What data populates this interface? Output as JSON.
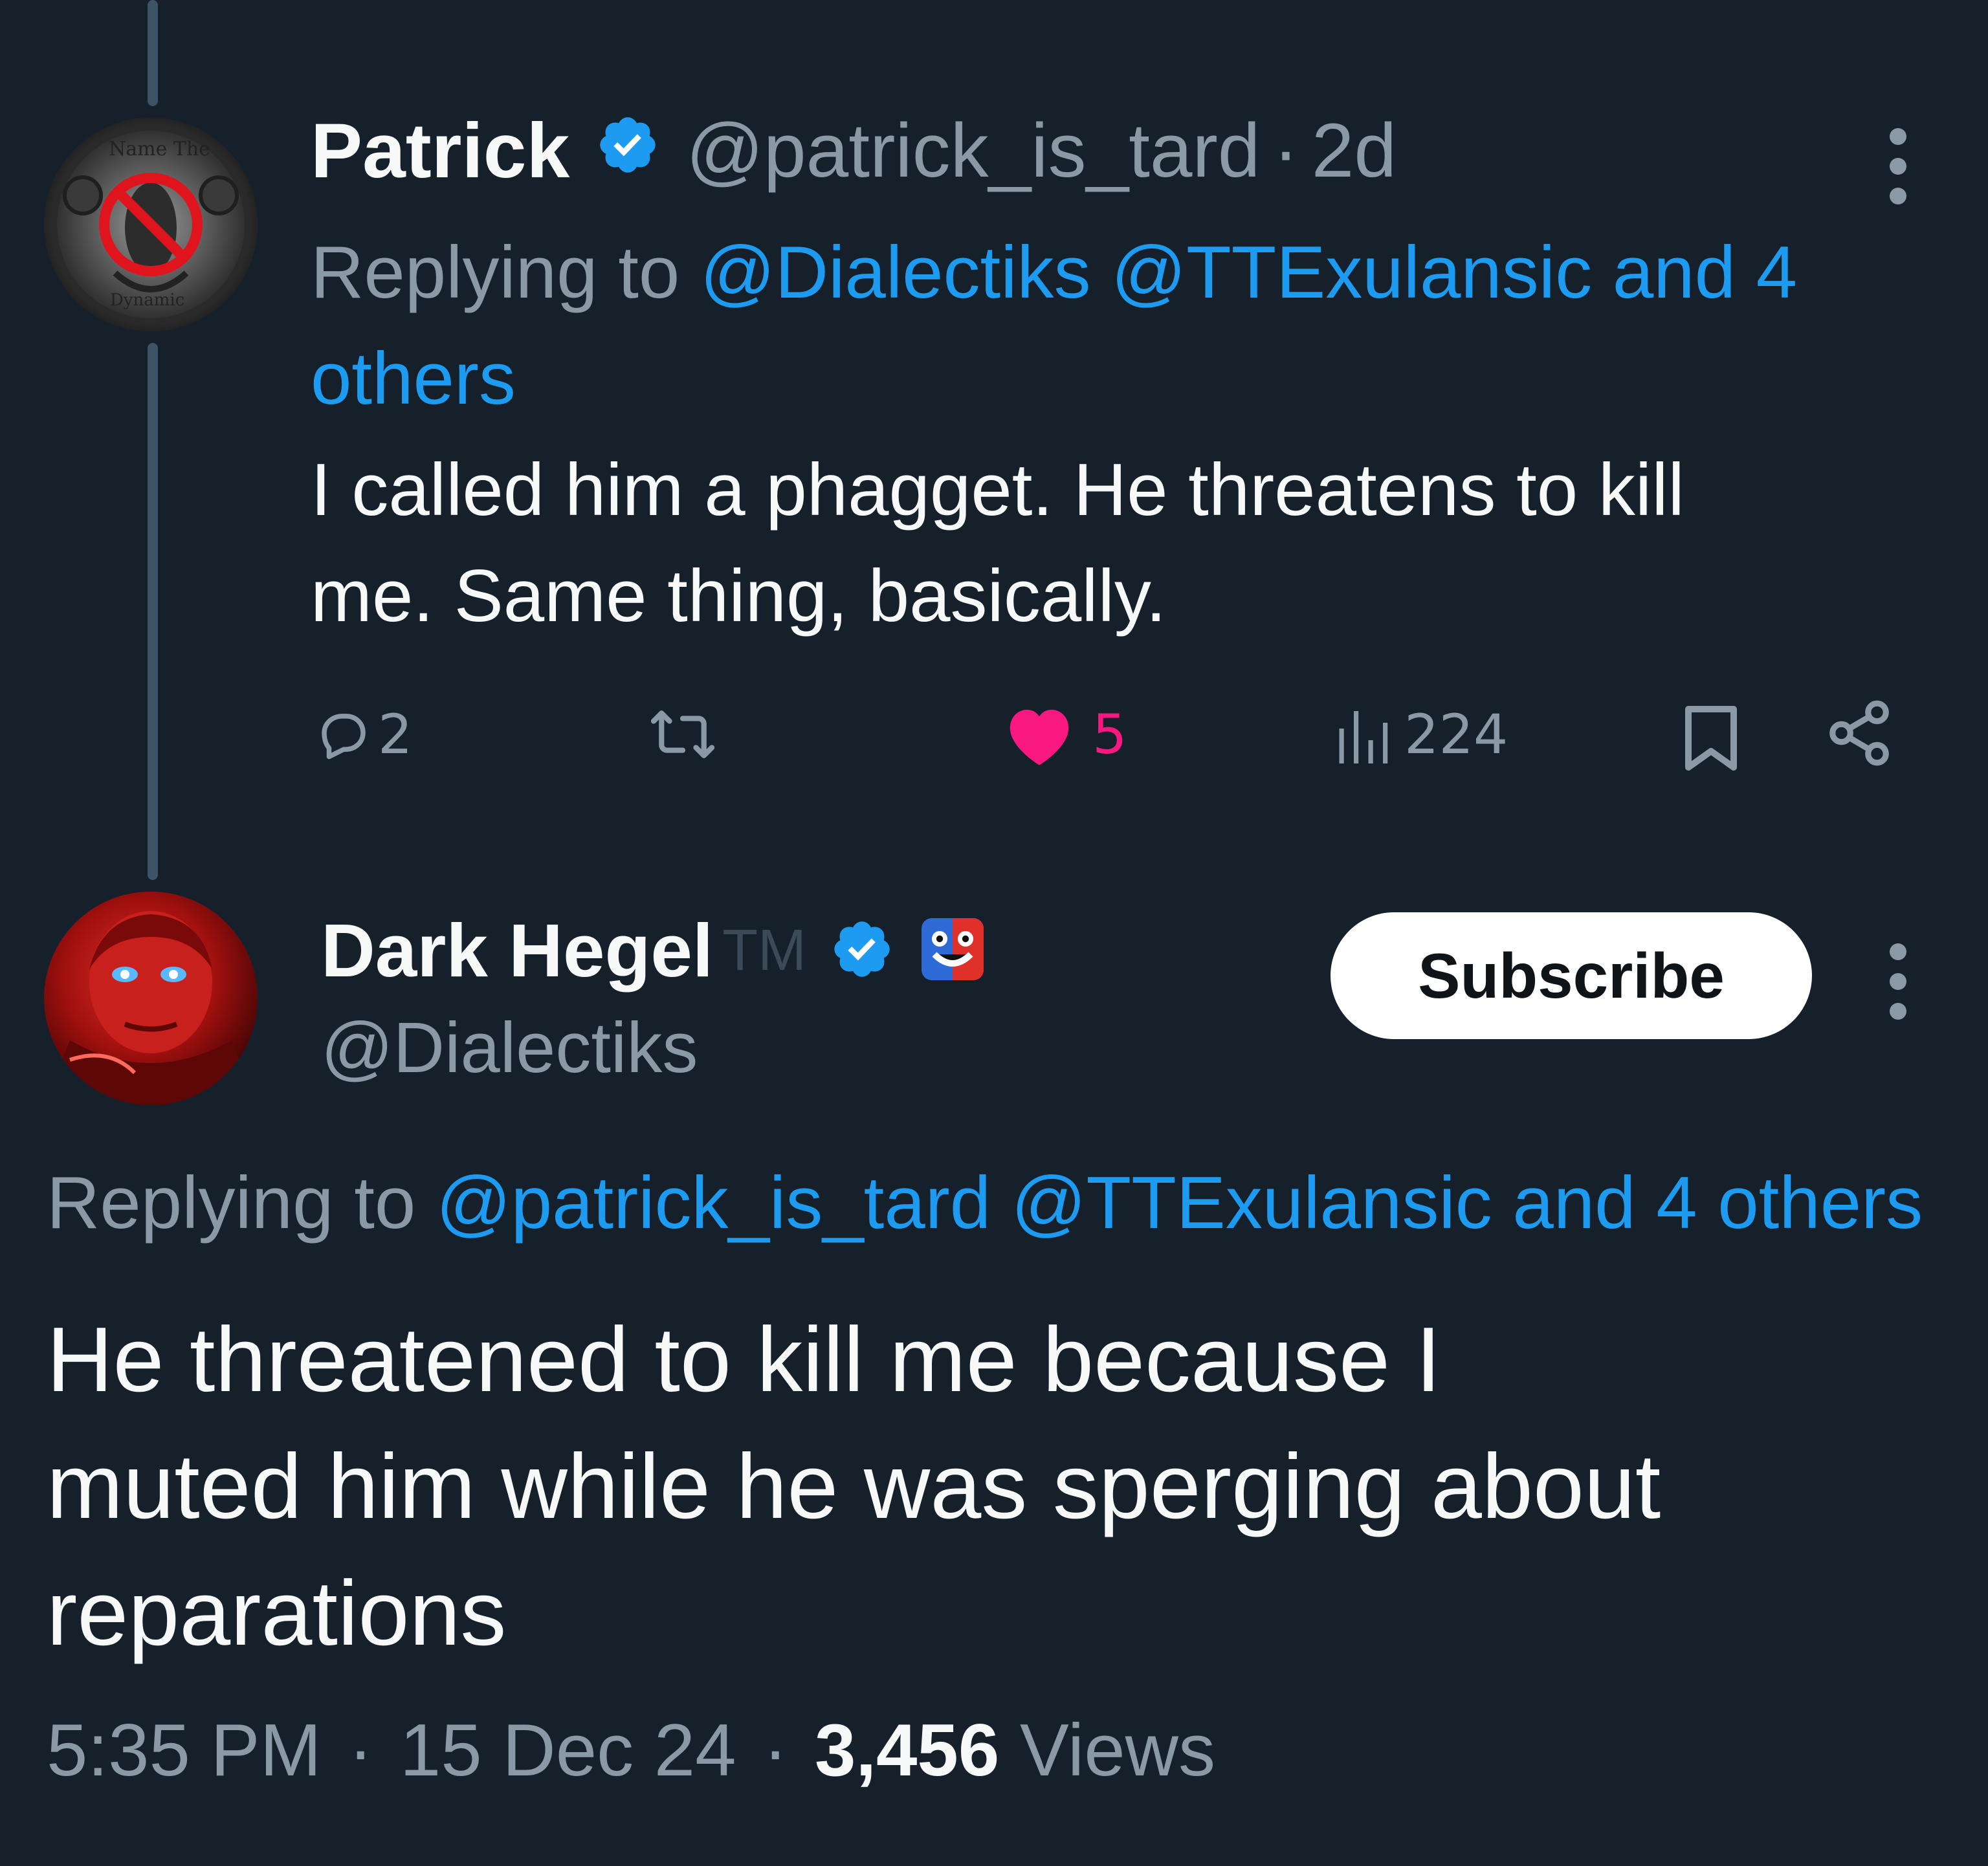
{
  "reply_tweet": {
    "display_name": "Patrick",
    "handle": "@patrick_is_tard",
    "separator": "·",
    "time_ago": "2d",
    "replying_prefix": "Replying to",
    "replying_mentions_line1": "@Dialectiks @TTExulansic and 4",
    "replying_mentions_line2": "others",
    "avatar_text_top": "Name The",
    "avatar_text_bottom": "Dynamic",
    "body_line1": "I called him a phagget. He threatens to kill",
    "body_line2": "me. Same thing, basically.",
    "actions": {
      "replies": "2",
      "retweets": "",
      "likes": "5",
      "views": "224"
    },
    "colors": {
      "like": "#f91880"
    }
  },
  "main_tweet": {
    "display_name": "Dark Hegel",
    "trademark": "TM",
    "handle": "@Dialectiks",
    "subscribe_label": "Subscribe",
    "replying_prefix": "Replying to",
    "replying_mentions": "@patrick_is_tard @TTExulansic and 4 others",
    "body_line1": "He threatened to kill me because I",
    "body_line2": "muted him while he was sperging about",
    "body_line3": "reparations",
    "time": "5:35 PM",
    "sep1": "·",
    "date": "15 Dec 24",
    "sep2": "·",
    "views_count": "3,456",
    "views_label": "Views"
  }
}
